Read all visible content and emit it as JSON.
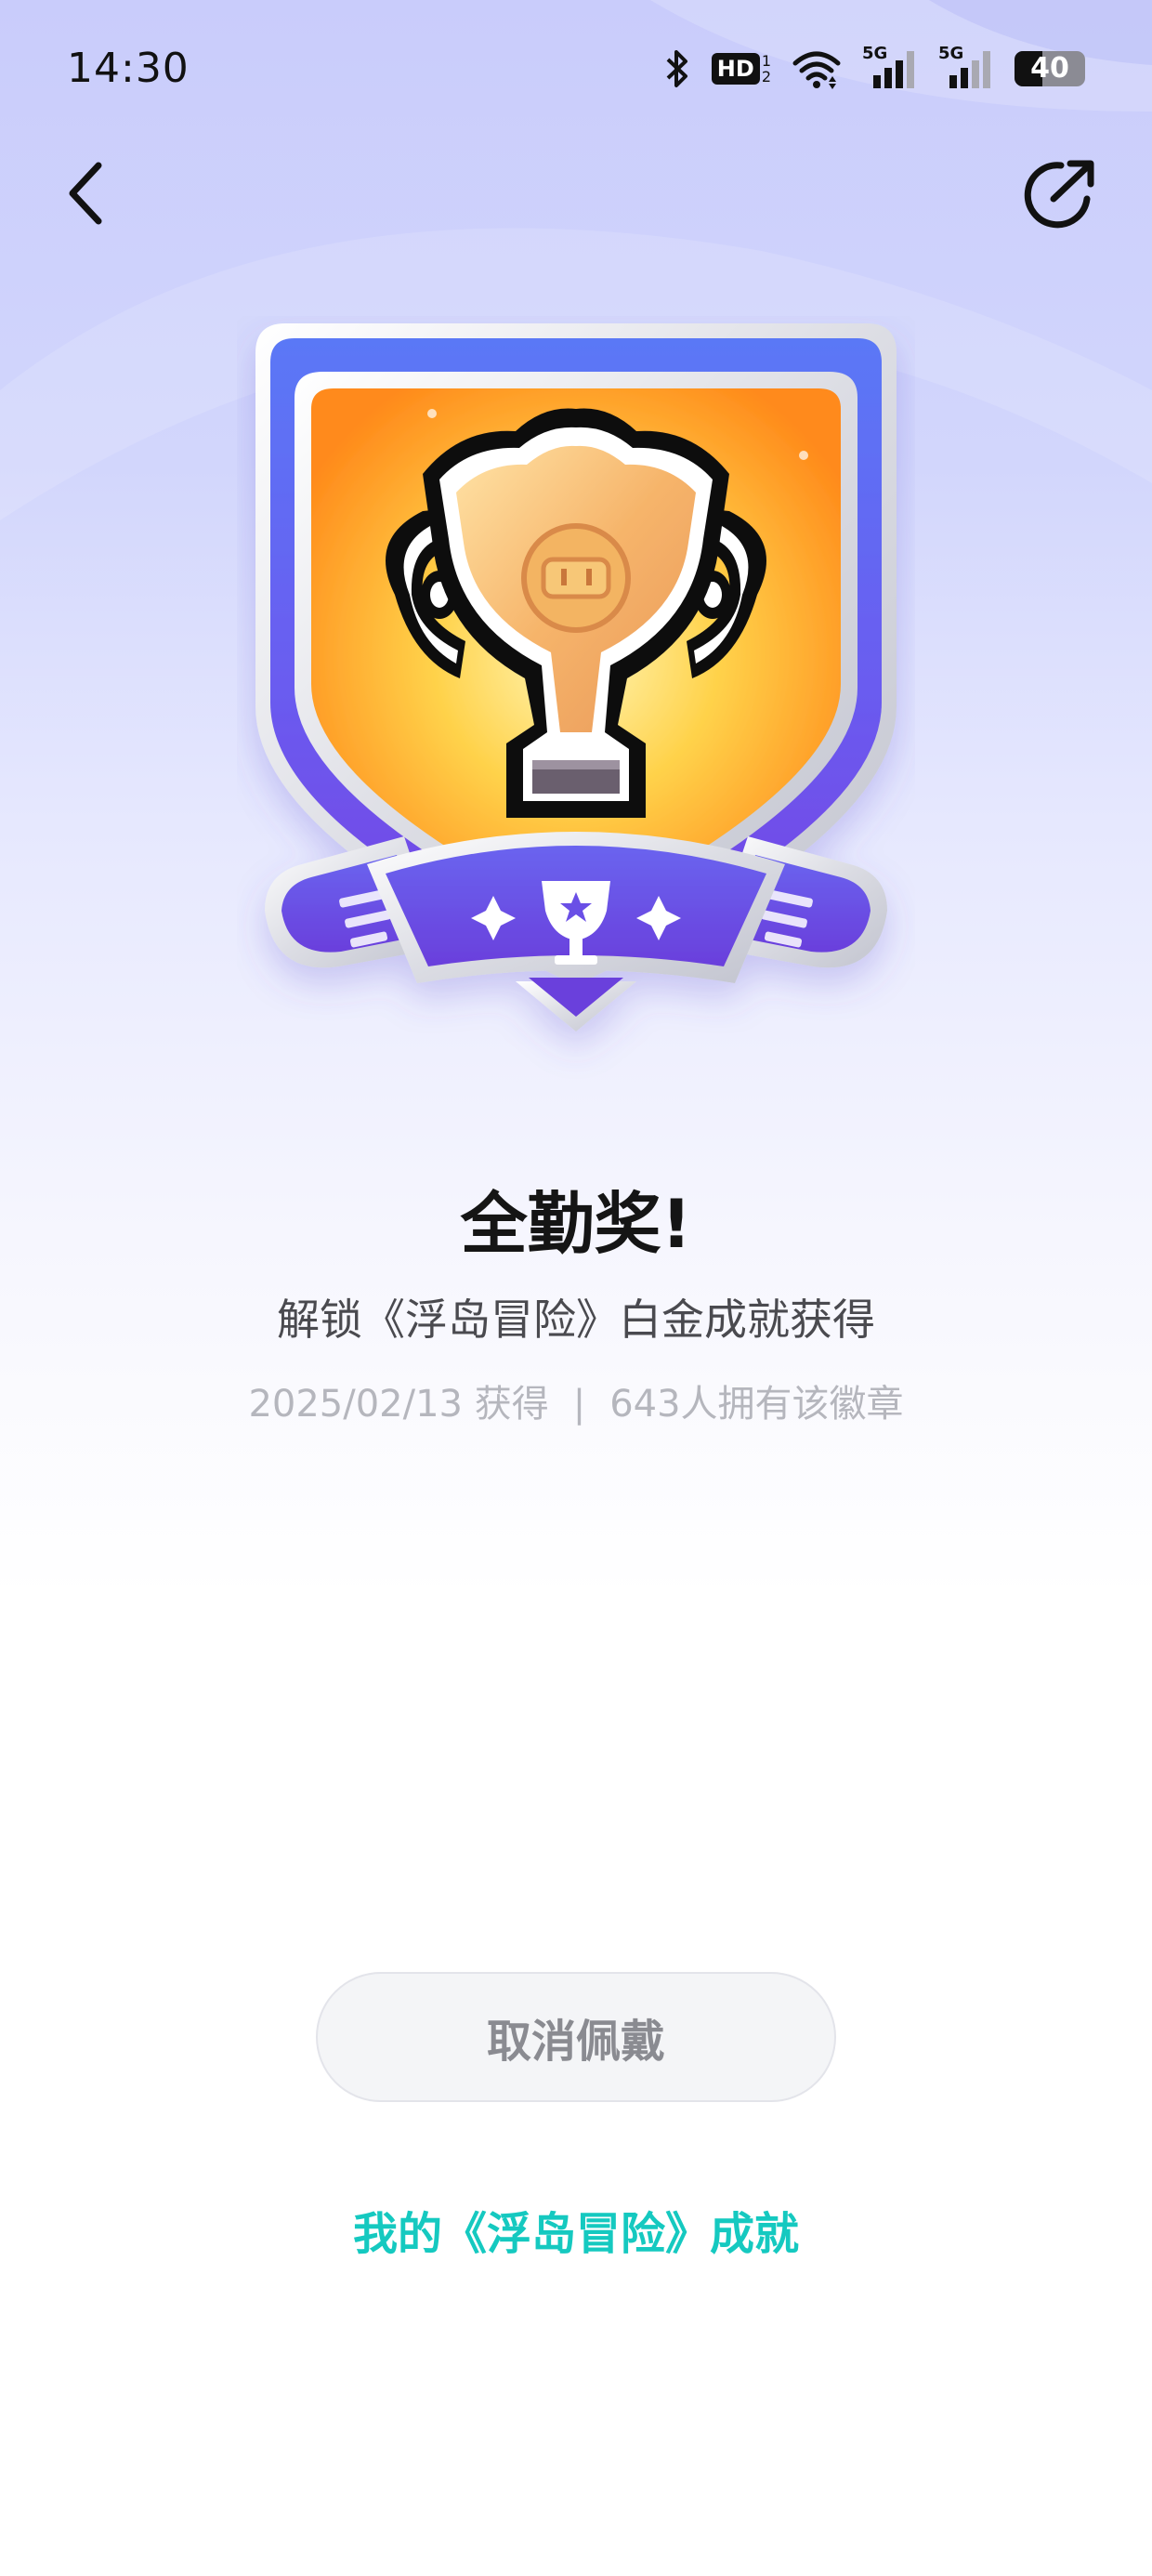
{
  "status_bar": {
    "time": "14:30",
    "hd_label": "HD",
    "hd_sub": "1",
    "hd_sub2": "2",
    "signal1_label": "5G",
    "signal2_label": "5G",
    "battery_level": 40,
    "battery_text": "40",
    "icons": [
      "bluetooth-icon",
      "hd-icon",
      "wifi-icon",
      "signal-5g-icon",
      "signal-5g-icon",
      "battery-icon"
    ]
  },
  "nav": {
    "back_icon": "chevron-left-icon",
    "share_icon": "share-icon"
  },
  "badge": {
    "icon": "pixel-trophy-badge",
    "colors": {
      "blue": "#5b6cf2",
      "purple": "#7046e6",
      "orange": "#ff9a1a",
      "silver": "#dcdce4",
      "gold": "#f3c35a"
    }
  },
  "award": {
    "title": "全勤奖!",
    "subtitle": "解锁《浮岛冒险》白金成就获得",
    "date": "2025/02/13 获得",
    "separator": "|",
    "owners": "643人拥有该徽章"
  },
  "actions": {
    "cancel_label": "取消佩戴",
    "link_label": "我的《浮岛冒险》成就"
  },
  "colors": {
    "accent": "#15c9c0",
    "background_top": "#c9ccfb"
  }
}
